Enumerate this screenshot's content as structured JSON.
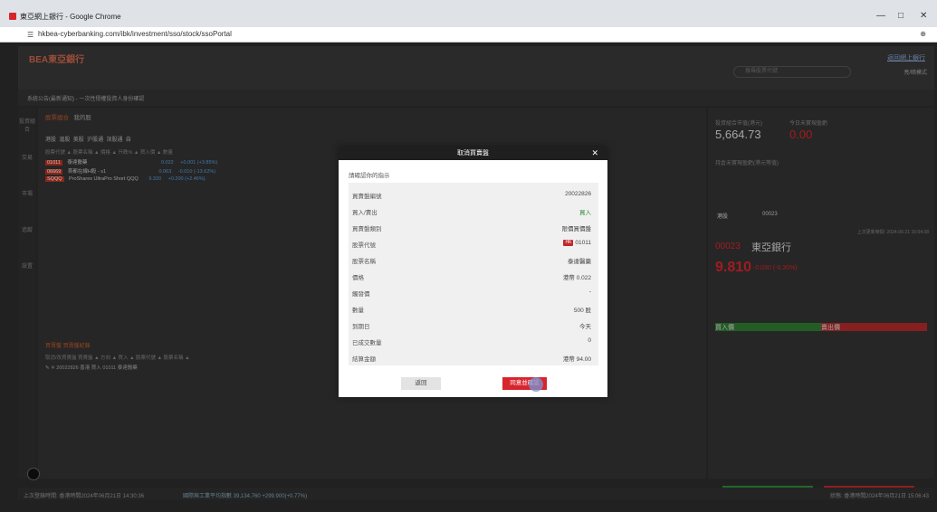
{
  "window": {
    "title": "東亞網上銀行 - Google Chrome",
    "url": "hkbea-cyberbanking.com/ibk/investment/sso/stock/ssoPortal",
    "minimize": "—",
    "maximize": "□",
    "close": "✕"
  },
  "app": {
    "logo": "BEA東亞銀行",
    "back_link": "返回網上銀行",
    "search_placeholder": "搜尋股票代號",
    "mode_label": "亮/暗模式",
    "notice": "系統公告(最新通知) - 一次性授權投資人身份確認",
    "tabs": [
      "股票組合",
      "我的股"
    ],
    "sub_tabs": [
      "港股",
      "滬股",
      "美股",
      "沪股通",
      "深股通",
      "自"
    ],
    "table_head": "股票代號 ▲   股票名稱 ▲                 價格 ▲    升跌% ▲  買入價 ▲  數量",
    "rows": [
      {
        "code": "01011",
        "name": "泰達醫藥",
        "price": "0.022",
        "change": "+0.001 (+3.85%)"
      },
      {
        "code": "06669",
        "name": "首都在線H股 - s1",
        "price": "0.063",
        "change": "-0.010 (-13.62%)"
      },
      {
        "code": "SQQQ",
        "name": "ProShares UltraPro Short QQQ",
        "price": "9.320",
        "change": "+0.200 (+2.46%)"
      }
    ],
    "orders_tabs": "買賣盤   買賣盤紀錄",
    "orders_head": "取消/改買賣盤   買賣盤 ▲   方向 ▲   買入 ▲   股票代號 ▲   股票名稱 ▲",
    "orders_row": "✎ ✕      20022826    香港    買入   01011   泰達醫藥",
    "nav": [
      "投資組合",
      "交易",
      "市場",
      "追蹤",
      "設置"
    ]
  },
  "right_panel": {
    "portfolio_label": "投資組合市值(港元)",
    "portfolio_value": "5,664.73",
    "today_pl_label": "今日未實現盈虧",
    "today_pl_value": "0.00",
    "unrealized_label": "持倉未實現盈虧(港元等值)",
    "market_select": "港股",
    "stock_search": "00023",
    "update_time": "上次更新時間: 2024-06-21 15:04:38",
    "stock_code": "00023",
    "stock_name": "東亞銀行",
    "price": "9.810",
    "change": "-0.030 (-0.30%)",
    "book_bid": "買入價",
    "book_ask": "賣出價",
    "buy": "買入",
    "sell": "賣出"
  },
  "status": {
    "last_login": "上次登錄時間: 香港時間2024年06月21日 14:30:36",
    "index": "國際與工業平均指數 39,134.760 +299.900(+0.77%)",
    "time": "狀態: 香港時間2024年06月21日 15:06:43"
  },
  "modal": {
    "title": "取消買賣盤",
    "close": "✕",
    "prompt": "請確認你的指示",
    "rows": [
      {
        "label": "買賣盤編號",
        "value": "20022826",
        "style": ""
      },
      {
        "label": "買入/賣出",
        "value": "買入",
        "style": "green"
      },
      {
        "label": "買賣盤類別",
        "value": "限價買價盤",
        "style": ""
      },
      {
        "label": "股票代號",
        "value": "01011",
        "style": "tag"
      },
      {
        "label": "股票名稱",
        "value": "泰達醫藥",
        "style": ""
      },
      {
        "label": "價格",
        "value": "港幣 0.022",
        "style": ""
      },
      {
        "label": "觸發價",
        "value": "-",
        "style": ""
      },
      {
        "label": "數量",
        "value": "500 股",
        "style": ""
      },
      {
        "label": "到期日",
        "value": "今天",
        "style": ""
      },
      {
        "label": "已成交數量",
        "value": "0",
        "style": ""
      },
      {
        "label": "結算金額",
        "value": "港幣 94.00",
        "style": ""
      }
    ],
    "stock_tag": "HK",
    "back_button": "返回",
    "confirm_button": "同意並確認"
  },
  "colors": {
    "accent_red": "#d8252d",
    "buy_green": "#2e8b3c",
    "dark_bg": "#2c2c2c"
  }
}
